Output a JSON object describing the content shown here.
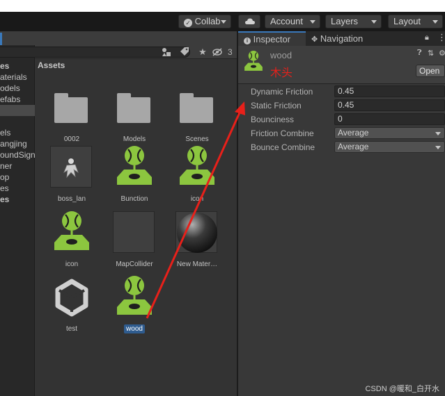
{
  "toolbar": {
    "collab_label": "Collab",
    "account_label": "Account",
    "layers_label": "Layers",
    "layout_label": "Layout"
  },
  "hierarchy": {
    "items": [
      {
        "label": "es",
        "style": "bold"
      },
      {
        "label": "aterials",
        "style": ""
      },
      {
        "label": "odels",
        "style": ""
      },
      {
        "label": "efabs",
        "style": ""
      },
      {
        "label": "",
        "style": "sel"
      },
      {
        "label": "",
        "style": ""
      },
      {
        "label": "els",
        "style": ""
      },
      {
        "label": "angjing",
        "style": ""
      },
      {
        "label": "oundSign",
        "style": ""
      },
      {
        "label": "ner",
        "style": ""
      },
      {
        "label": "op",
        "style": ""
      },
      {
        "label": "es",
        "style": ""
      },
      {
        "label": "es",
        "style": "bold"
      }
    ]
  },
  "project": {
    "hidden_count": "3",
    "assets_title": "Assets"
  },
  "assets": [
    {
      "name": "0002",
      "kind": "folder"
    },
    {
      "name": "Models",
      "kind": "folder"
    },
    {
      "name": "Scenes",
      "kind": "folder"
    },
    {
      "name": "boss_lan",
      "kind": "texture"
    },
    {
      "name": "Bunction",
      "kind": "physic-material"
    },
    {
      "name": "icon",
      "kind": "physic-material"
    },
    {
      "name": "icon",
      "kind": "physic-material"
    },
    {
      "name": "MapCollider",
      "kind": "empty"
    },
    {
      "name": "New Mater…",
      "kind": "material-sphere"
    },
    {
      "name": "test",
      "kind": "unity-logo"
    },
    {
      "name": "wood",
      "kind": "physic-material",
      "selected": true
    }
  ],
  "inspector": {
    "tab_inspector": "Inspector",
    "tab_navigation": "Navigation",
    "asset_name": "wood",
    "annotation": "木头",
    "annotation_color": "#e8201a",
    "open_label": "Open",
    "properties": [
      {
        "label": "Dynamic Friction",
        "value": "0.45",
        "kind": "field"
      },
      {
        "label": "Static Friction",
        "value": "0.45",
        "kind": "field"
      },
      {
        "label": "Bounciness",
        "value": "0",
        "kind": "field"
      },
      {
        "label": "Friction Combine",
        "value": "Average",
        "kind": "dropdown"
      },
      {
        "label": "Bounce Combine",
        "value": "Average",
        "kind": "dropdown"
      }
    ]
  },
  "watermark": "CSDN @暖和_白开水",
  "colors": {
    "accent_green": "#8cc63f",
    "selection_blue": "#2f5c8f",
    "arrow_red": "#e8201a"
  }
}
